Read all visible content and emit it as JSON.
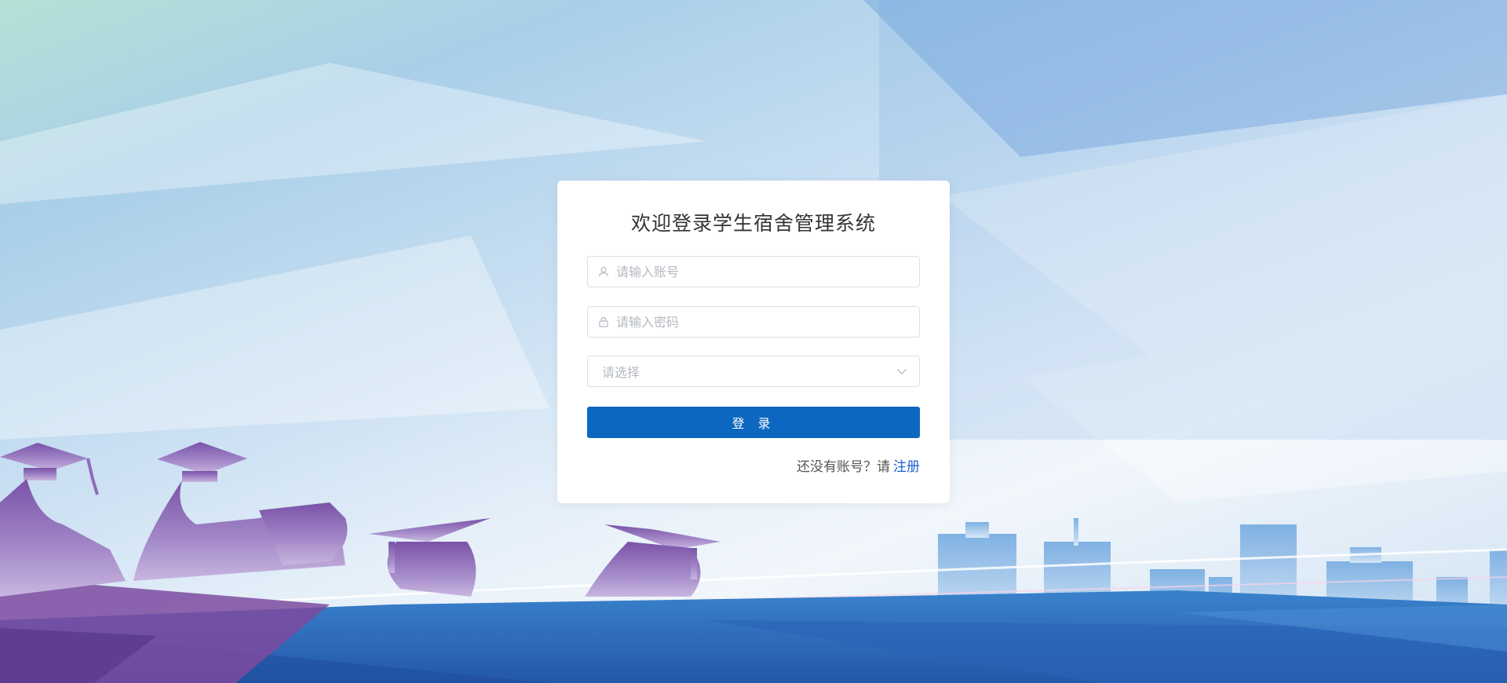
{
  "login": {
    "title": "欢迎登录学生宿舍管理系统",
    "username_placeholder": "请输入账号",
    "password_placeholder": "请输入密码",
    "role_select_placeholder": "请选择",
    "login_button_label": "登 录",
    "register_prompt": "还没有账号？请",
    "register_link_label": "注册"
  },
  "icons": {
    "username": "user-icon",
    "password": "lock-icon",
    "select": "chevron-down-icon"
  },
  "colors": {
    "primary_button": "#0c67c0",
    "link": "#1f5fd1",
    "graduate_silhouette": "#8e6bb8",
    "ground_blue": "#2e6fc0"
  }
}
